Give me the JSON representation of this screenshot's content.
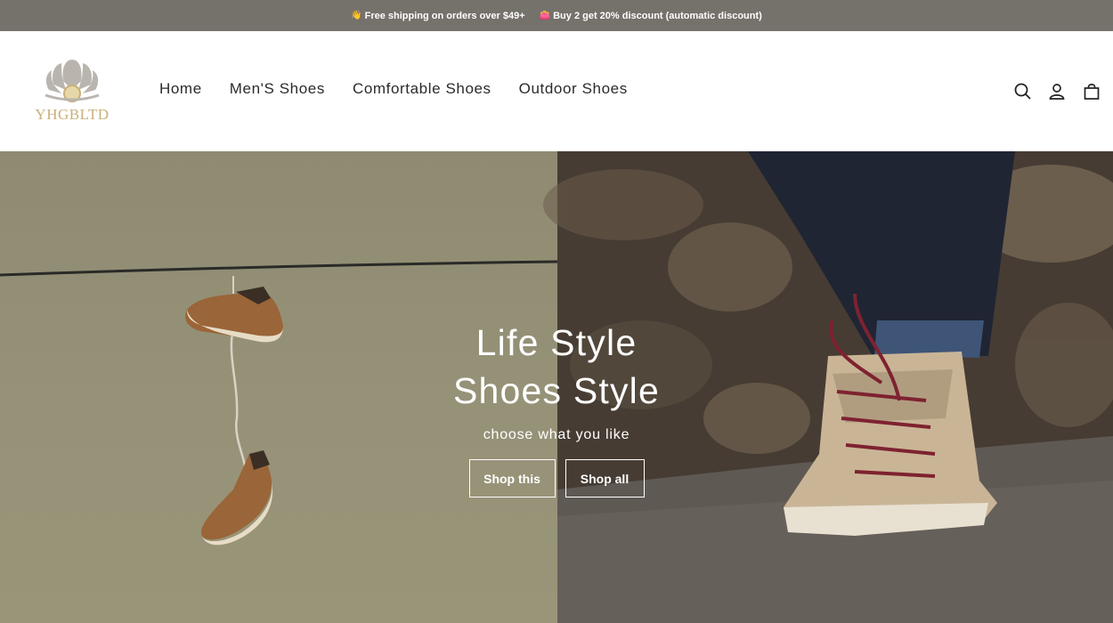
{
  "announcement": {
    "items": [
      {
        "emoji": "👋",
        "text": "Free shipping on orders over $49+"
      },
      {
        "emoji": "👛",
        "text": "Buy 2 get 20% discount (automatic discount)"
      }
    ]
  },
  "header": {
    "logo_text": "YHGBLTD",
    "nav": [
      "Home",
      "Men'S Shoes",
      "Comfortable Shoes",
      "Outdoor Shoes"
    ],
    "icons": [
      "search-icon",
      "account-icon",
      "cart-icon"
    ]
  },
  "hero": {
    "title_line1": "Life Style",
    "title_line2": "Shoes Style",
    "subtitle": "choose what you like",
    "buttons": [
      "Shop this",
      "Shop all"
    ]
  },
  "colors": {
    "announcement_bg": "#75716b",
    "logo_gold": "#c9b07a",
    "text_dark": "#2b2b2b",
    "hero_left_bg": "#959177",
    "hero_right_bg": "#463c33"
  }
}
